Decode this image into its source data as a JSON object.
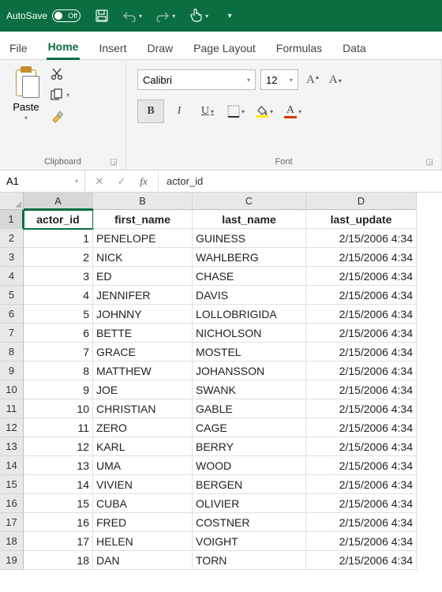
{
  "title_bar": {
    "autosave_label": "AutoSave",
    "autosave_state": "Off"
  },
  "tabs": [
    "File",
    "Home",
    "Insert",
    "Draw",
    "Page Layout",
    "Formulas",
    "Data"
  ],
  "active_tab": "Home",
  "ribbon": {
    "clipboard": {
      "paste_label": "Paste",
      "group_label": "Clipboard"
    },
    "font": {
      "font_name": "Calibri",
      "font_size": "12",
      "group_label": "Font",
      "bold": "B",
      "italic": "I",
      "underline": "U",
      "inc_A": "A",
      "dec_A": "A",
      "fill_A": "A"
    }
  },
  "name_box": "A1",
  "fx_label": "fx",
  "formula_value": "actor_id",
  "columns": [
    "A",
    "B",
    "C",
    "D"
  ],
  "header_row": [
    "actor_id",
    "first_name",
    "last_name",
    "last_update"
  ],
  "rows": [
    {
      "n": 1,
      "a": "1",
      "b": "PENELOPE",
      "c": "GUINESS",
      "d": "2/15/2006 4:34"
    },
    {
      "n": 2,
      "a": "2",
      "b": "NICK",
      "c": "WAHLBERG",
      "d": "2/15/2006 4:34"
    },
    {
      "n": 3,
      "a": "3",
      "b": "ED",
      "c": "CHASE",
      "d": "2/15/2006 4:34"
    },
    {
      "n": 4,
      "a": "4",
      "b": "JENNIFER",
      "c": "DAVIS",
      "d": "2/15/2006 4:34"
    },
    {
      "n": 5,
      "a": "5",
      "b": "JOHNNY",
      "c": "LOLLOBRIGIDA",
      "d": "2/15/2006 4:34"
    },
    {
      "n": 6,
      "a": "6",
      "b": "BETTE",
      "c": "NICHOLSON",
      "d": "2/15/2006 4:34"
    },
    {
      "n": 7,
      "a": "7",
      "b": "GRACE",
      "c": "MOSTEL",
      "d": "2/15/2006 4:34"
    },
    {
      "n": 8,
      "a": "8",
      "b": "MATTHEW",
      "c": "JOHANSSON",
      "d": "2/15/2006 4:34"
    },
    {
      "n": 9,
      "a": "9",
      "b": "JOE",
      "c": "SWANK",
      "d": "2/15/2006 4:34"
    },
    {
      "n": 10,
      "a": "10",
      "b": "CHRISTIAN",
      "c": "GABLE",
      "d": "2/15/2006 4:34"
    },
    {
      "n": 11,
      "a": "11",
      "b": "ZERO",
      "c": "CAGE",
      "d": "2/15/2006 4:34"
    },
    {
      "n": 12,
      "a": "12",
      "b": "KARL",
      "c": "BERRY",
      "d": "2/15/2006 4:34"
    },
    {
      "n": 13,
      "a": "13",
      "b": "UMA",
      "c": "WOOD",
      "d": "2/15/2006 4:34"
    },
    {
      "n": 14,
      "a": "14",
      "b": "VIVIEN",
      "c": "BERGEN",
      "d": "2/15/2006 4:34"
    },
    {
      "n": 15,
      "a": "15",
      "b": "CUBA",
      "c": "OLIVIER",
      "d": "2/15/2006 4:34"
    },
    {
      "n": 16,
      "a": "16",
      "b": "FRED",
      "c": "COSTNER",
      "d": "2/15/2006 4:34"
    },
    {
      "n": 17,
      "a": "17",
      "b": "HELEN",
      "c": "VOIGHT",
      "d": "2/15/2006 4:34"
    },
    {
      "n": 18,
      "a": "18",
      "b": "DAN",
      "c": "TORN",
      "d": "2/15/2006 4:34"
    }
  ]
}
